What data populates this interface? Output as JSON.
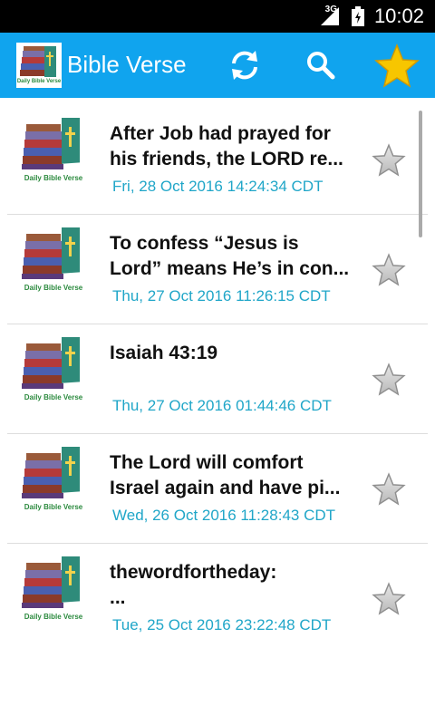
{
  "status_bar": {
    "network": "3G",
    "time": "10:02"
  },
  "app_bar": {
    "title": "Bible Verse",
    "logo_text": "Daily Bible Verse",
    "icons": [
      "refresh-icon",
      "search-icon",
      "favorites-star-icon"
    ]
  },
  "colors": {
    "app_bar": "#10a4ee",
    "date_text": "#20a6c8",
    "star": "#f7c600"
  },
  "verses": [
    {
      "title": "After Job had prayed for\nhis friends, the LORD re...",
      "date": "Fri, 28 Oct 2016 14:24:34 CDT",
      "thumb_caption": "Daily Bible Verse"
    },
    {
      "title": "To confess “Jesus is\nLord” means He’s in con...",
      "date": "Thu, 27 Oct 2016 11:26:15 CDT",
      "thumb_caption": "Daily Bible Verse"
    },
    {
      "title": "Isaiah 43:19",
      "date": "Thu, 27 Oct 2016 01:44:46 CDT",
      "thumb_caption": "Daily Bible Verse"
    },
    {
      "title": "The Lord will comfort\nIsrael again and have pi...",
      "date": "Wed, 26 Oct 2016 11:28:43 CDT",
      "thumb_caption": "Daily Bible Verse"
    },
    {
      "title": "thewordfortheday:\n...",
      "date": "Tue, 25 Oct 2016 23:22:48 CDT",
      "thumb_caption": "Daily Bible Verse"
    }
  ]
}
